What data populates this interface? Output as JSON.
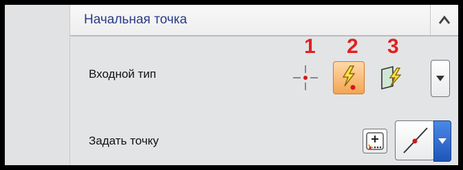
{
  "header": {
    "title": "Начальная точка"
  },
  "rows": [
    {
      "label": "Входной тип"
    },
    {
      "label": "Задать точку"
    }
  ],
  "markers": [
    "1",
    "2",
    "3"
  ],
  "icons": {
    "option1": "point-crosshair-icon",
    "option2": "lightning-point-icon",
    "option3": "lightning-plane-icon",
    "dropdown": "chevron-down-icon",
    "collapse": "chevron-up-icon",
    "point_dialog": "point-dialog-icon",
    "inferred_point": "line-point-icon"
  },
  "colors": {
    "marker": "#e02020",
    "title": "#2a3a85",
    "active_button": "#f4a552",
    "dropdown_blue": "#2f6fd1"
  }
}
